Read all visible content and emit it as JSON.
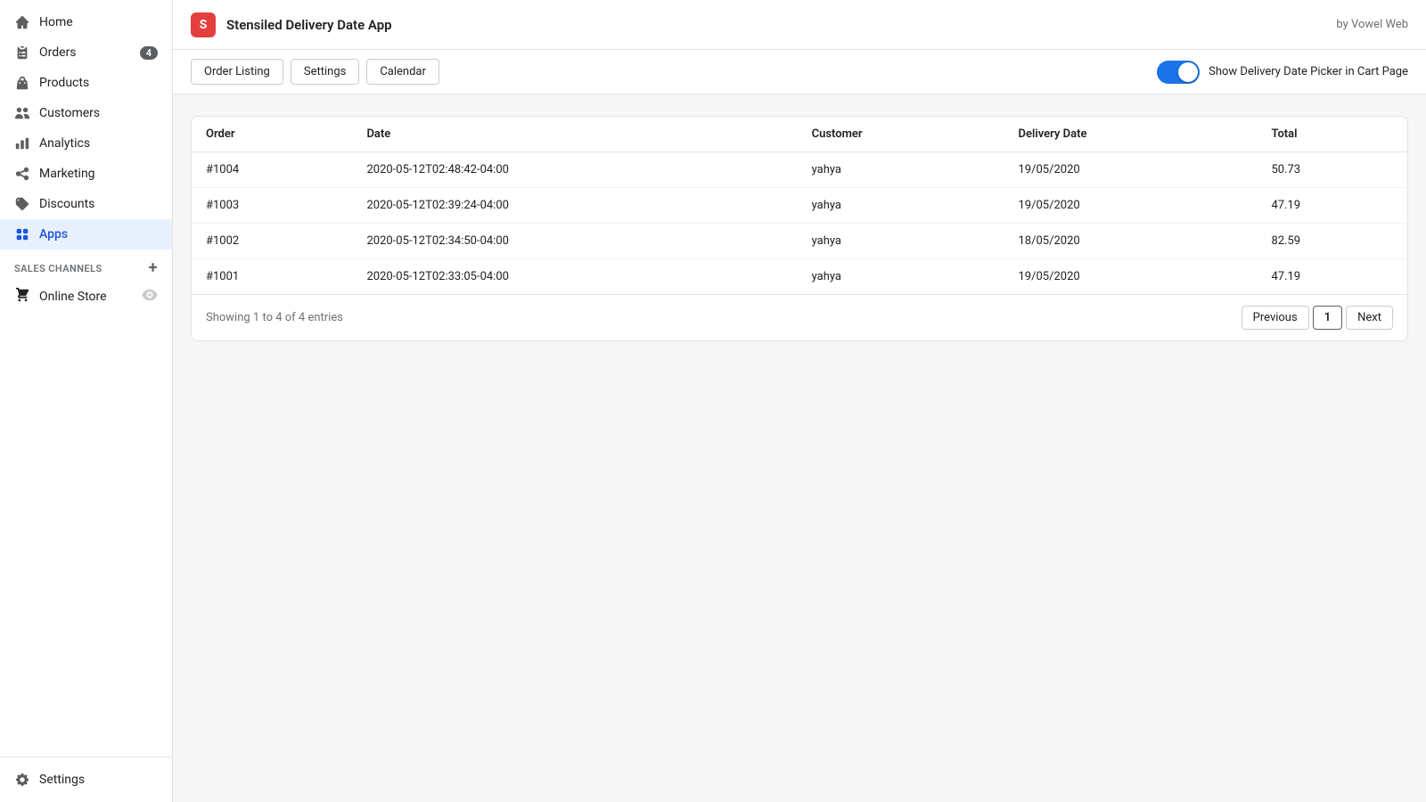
{
  "sidebar": {
    "items": [
      {
        "id": "home",
        "label": "Home",
        "icon": "home",
        "badge": null,
        "active": false
      },
      {
        "id": "orders",
        "label": "Orders",
        "icon": "orders",
        "badge": "4",
        "active": false
      },
      {
        "id": "products",
        "label": "Products",
        "icon": "products",
        "badge": null,
        "active": false
      },
      {
        "id": "customers",
        "label": "Customers",
        "icon": "customers",
        "badge": null,
        "active": false
      },
      {
        "id": "analytics",
        "label": "Analytics",
        "icon": "analytics",
        "badge": null,
        "active": false
      },
      {
        "id": "marketing",
        "label": "Marketing",
        "icon": "marketing",
        "badge": null,
        "active": false
      },
      {
        "id": "discounts",
        "label": "Discounts",
        "icon": "discounts",
        "badge": null,
        "active": false
      },
      {
        "id": "apps",
        "label": "Apps",
        "icon": "apps",
        "badge": null,
        "active": true
      }
    ],
    "sales_channels_label": "SALES CHANNELS",
    "online_store_label": "Online Store",
    "settings_label": "Settings"
  },
  "topbar": {
    "app_title": "Stensiled Delivery Date App",
    "by_label": "by Vowel Web"
  },
  "tabs": [
    {
      "id": "order-listing",
      "label": "Order Listing"
    },
    {
      "id": "settings",
      "label": "Settings"
    },
    {
      "id": "calendar",
      "label": "Calendar"
    }
  ],
  "toggle": {
    "label": "Show Delivery Date Picker in Cart Page",
    "enabled": true
  },
  "table": {
    "columns": [
      "Order",
      "Date",
      "Customer",
      "Delivery Date",
      "Total"
    ],
    "rows": [
      {
        "order": "#1004",
        "date": "2020-05-12T02:48:42-04:00",
        "customer": "yahya",
        "delivery_date": "19/05/2020",
        "total": "50.73"
      },
      {
        "order": "#1003",
        "date": "2020-05-12T02:39:24-04:00",
        "customer": "yahya",
        "delivery_date": "19/05/2020",
        "total": "47.19"
      },
      {
        "order": "#1002",
        "date": "2020-05-12T02:34:50-04:00",
        "customer": "yahya",
        "delivery_date": "18/05/2020",
        "total": "82.59"
      },
      {
        "order": "#1001",
        "date": "2020-05-12T02:33:05-04:00",
        "customer": "yahya",
        "delivery_date": "19/05/2020",
        "total": "47.19"
      }
    ],
    "footer": {
      "showing": "Showing 1 to 4 of 4 entries",
      "previous": "Previous",
      "next": "Next",
      "current_page": "1"
    }
  }
}
